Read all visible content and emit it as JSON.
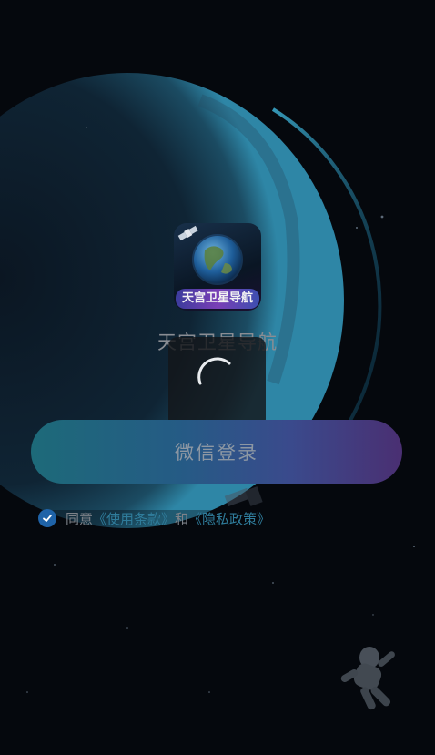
{
  "app": {
    "logo_badge_text": "天宫卫星导航",
    "title": "天宫卫星导航"
  },
  "login": {
    "wechat_button_label": "微信登录"
  },
  "agreement": {
    "checked": true,
    "prefix": "同意",
    "terms_link": "《使用条款》",
    "conjunction": "和",
    "privacy_link": "《隐私政策》"
  },
  "colors": {
    "button_gradient_start": "#1d6a79",
    "button_gradient_end": "#4a2f72",
    "checkbox": "#1f63a8",
    "link": "#2f7c9b"
  },
  "icons": [
    "satellite-icon",
    "earth-icon",
    "loading-spinner-icon",
    "checkmark-icon",
    "astronaut-icon"
  ]
}
